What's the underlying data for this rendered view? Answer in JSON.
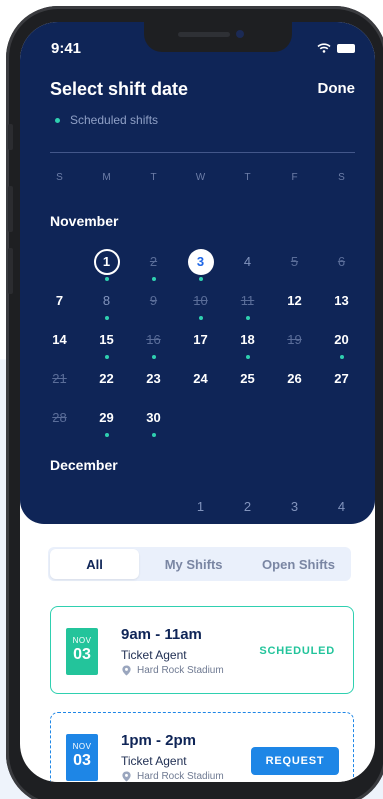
{
  "status_bar": {
    "time": "9:41"
  },
  "header": {
    "title": "Select shift date",
    "done_label": "Done",
    "legend": "Scheduled shifts"
  },
  "weekdays": [
    "S",
    "M",
    "T",
    "W",
    "T",
    "F",
    "S"
  ],
  "november": {
    "label": "November",
    "days": [
      {
        "n": "",
        "s": "empty"
      },
      {
        "n": "1",
        "s": "ring",
        "dot": true
      },
      {
        "n": "2",
        "s": "dim",
        "dot": true
      },
      {
        "n": "3",
        "s": "sel",
        "dot": true
      },
      {
        "n": "4",
        "s": "light"
      },
      {
        "n": "5",
        "s": "dim"
      },
      {
        "n": "6",
        "s": "dim"
      },
      {
        "n": "7",
        "s": "normal"
      },
      {
        "n": "8",
        "s": "light",
        "dot": true
      },
      {
        "n": "9",
        "s": "dim"
      },
      {
        "n": "10",
        "s": "dim",
        "dot": true
      },
      {
        "n": "11",
        "s": "dim",
        "dot": true
      },
      {
        "n": "12",
        "s": "normal"
      },
      {
        "n": "13",
        "s": "normal"
      },
      {
        "n": "14",
        "s": "normal"
      },
      {
        "n": "15",
        "s": "normal",
        "dot": true
      },
      {
        "n": "16",
        "s": "dim",
        "dot": true
      },
      {
        "n": "17",
        "s": "normal"
      },
      {
        "n": "18",
        "s": "normal",
        "dot": true
      },
      {
        "n": "19",
        "s": "dim"
      },
      {
        "n": "20",
        "s": "normal",
        "dot": true
      },
      {
        "n": "21",
        "s": "dim"
      },
      {
        "n": "22",
        "s": "normal"
      },
      {
        "n": "23",
        "s": "normal"
      },
      {
        "n": "24",
        "s": "normal"
      },
      {
        "n": "25",
        "s": "normal"
      },
      {
        "n": "26",
        "s": "normal"
      },
      {
        "n": "27",
        "s": "normal"
      },
      {
        "n": "28",
        "s": "dim"
      },
      {
        "n": "29",
        "s": "normal",
        "dot": true
      },
      {
        "n": "30",
        "s": "normal",
        "dot": true
      }
    ]
  },
  "december": {
    "label": "December",
    "days": [
      {
        "n": "",
        "s": "empty"
      },
      {
        "n": "",
        "s": "empty"
      },
      {
        "n": "",
        "s": "empty"
      },
      {
        "n": "1",
        "s": "light"
      },
      {
        "n": "2",
        "s": "light"
      },
      {
        "n": "3",
        "s": "light"
      },
      {
        "n": "4",
        "s": "light"
      }
    ]
  },
  "tabs": [
    "All",
    "My Shifts",
    "Open Shifts"
  ],
  "shifts": [
    {
      "month": "NOV",
      "day": "03",
      "time": "9am - 11am",
      "role": "Ticket Agent",
      "location": "Hard Rock Stadium",
      "status": "SCHEDULED"
    },
    {
      "month": "NOV",
      "day": "03",
      "time": "1pm - 2pm",
      "role": "Ticket Agent",
      "location": "Hard Rock Stadium",
      "action": "REQUEST"
    }
  ],
  "colors": {
    "panel": "#0f2557",
    "accent_green": "#23c49b",
    "accent_blue": "#1e86e6",
    "dot": "#2fd0b0"
  }
}
